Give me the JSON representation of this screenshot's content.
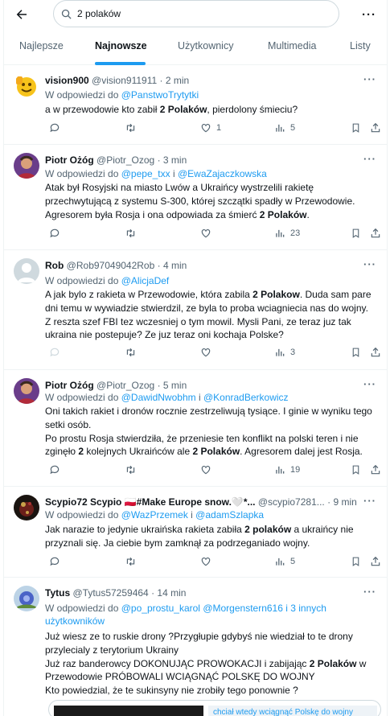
{
  "search": {
    "query": "2 polaków"
  },
  "tabs": [
    "Najlepsze",
    "Najnowsze",
    "Użytkownicy",
    "Multimedia",
    "Listy"
  ],
  "reply_prefix": "W odpowiedzi do",
  "tweets": [
    {
      "name": "vision900",
      "handle": "@vision911911",
      "time": "· 2 min",
      "reply_to_1": "@PanstwoTrytytki",
      "text_lines": [
        "a w przewodowie kto zabił ",
        "2 Polaków",
        ", pierdolony śmieciu?"
      ],
      "replies": "",
      "retweets": "",
      "likes": "1",
      "views": "5"
    },
    {
      "name": "Piotr Ożóg",
      "handle": "@Piotr_Ozog",
      "time": "· 3 min",
      "reply_to_1": "@pepe_txx",
      "reply_sep": " i ",
      "reply_to_2": "@EwaZajaczkowska",
      "text_a": "Atak był Rosyjski na miasto Lwów a Ukraińcy wystrzelili rakietę przechwytującą z systemu S-300, której szczątki spadły w Przewodowie. Agresorem była Rosja i ona odpowiada za śmierć ",
      "text_bold": "2 Polaków",
      "text_b": ".",
      "replies": "",
      "retweets": "",
      "likes": "",
      "views": "23"
    },
    {
      "name": "Rob",
      "handle": "@Rob97049042Rob",
      "time": "· 4 min",
      "reply_to_1": "@AlicjaDef",
      "text_a": "A jak bylo z rakieta w Przewodowie, która zabila ",
      "text_bold": "2 Polakow",
      "text_b": ". Duda sam pare dni temu w wywiadzie stwierdzil, ze byla to proba wciagniecia nas do wojny. Z reszta szef FBI tez wczesniej o tym mowil. Mysli Pani, ze teraz juz tak ukraina nie postepuje? Ze juz teraz oni kochaja Polske?",
      "replies": "",
      "retweets": "",
      "likes": "",
      "views": "3"
    },
    {
      "name": "Piotr Ożóg",
      "handle": "@Piotr_Ozog",
      "time": "· 5 min",
      "reply_to_1": "@DawidNwobhm",
      "reply_sep": " i ",
      "reply_to_2": "@KonradBerkowicz",
      "text_p1": "Oni takich rakiet i dronów rocznie zestrzeliwują tysiące. I ginie w wyniku tego setki osób.",
      "text_a": "Po prostu Rosja stwierdziła, że przeniesie ten konflikt na polski teren i nie zginęło ",
      "text_bold1": "2",
      "text_mid": " kolejnych Ukraińców ale ",
      "text_bold2": "2 Polaków",
      "text_b": ". Agresorem dalej jest Rosja.",
      "replies": "",
      "retweets": "",
      "likes": "",
      "views": "19"
    },
    {
      "name": "Scypio72 Scypio 🇵🇱#Make Europe snow.🤍*...",
      "handle": "@scypio7281...",
      "time": "· 9 min",
      "reply_to_1": "@WazPrzemek",
      "reply_sep": " i ",
      "reply_to_2": "@adamSzlapka",
      "text_a": "Jak narazie to jedynie ukraińska rakieta zabiła ",
      "text_bold": "2 polaków",
      "text_b": " a ukraińcy nie przyznali się. Ja ciebie bym zamknął za podrzeganiado  wojny.",
      "replies": "",
      "retweets": "",
      "likes": "",
      "views": "5"
    },
    {
      "name": "Tytus",
      "handle": "@Tytus57259464",
      "time": "· 14 min",
      "reply_to_1": "@po_prostu_karol",
      "reply_to_2": "@Morgenstern616",
      "reply_more": "i 3 innych użytkowników",
      "text_l1": "Już wiesz ze to ruskie drony ?Przygłupie gdybyś nie wiedział to te drony przylecialy z terytorium Ukrainy",
      "text_l2a": "Już raz banderowcy DOKONUJĄC PROWOKACJI i zabijając ",
      "text_l2b": "2 Polaków",
      "text_l2c": " w Przewodowie PRÓBOWALI WCIĄGNĄĆ POLSKĘ DO WOJNY",
      "text_l3": "Kto powiedzial, że te sukinsyny nie zrobiły tego ponownie ?",
      "card_text": "chciał wtedy wciągnąć Polskę do wojny"
    }
  ],
  "colors": {
    "accent": "#1d9bf0",
    "muted": "#536471",
    "text": "#0f1419"
  }
}
